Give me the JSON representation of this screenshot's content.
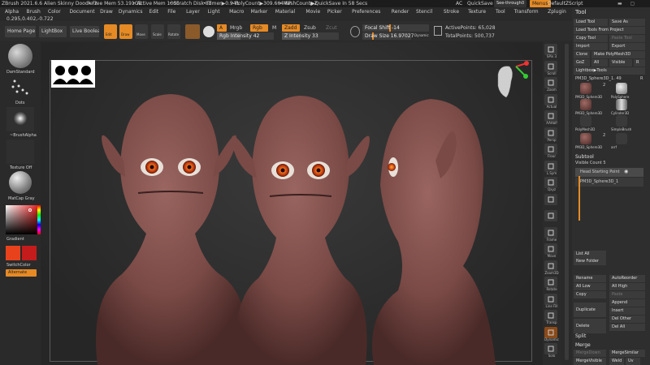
{
  "titlebar": {
    "app": "ZBrush 2021.6.6",
    "doc": "Alien Skinny Doodle 2",
    "free_mem": "• Free Mem 53.191GB",
    "active_mem": "• Active Mem 1305",
    "scratch": "• Scratch Disk 83",
    "timer": "• Timer▶0.941",
    "polycount": "• PolyCount▶309.664 KP",
    "meshcount": "• MeshCount▶2",
    "quicksave": "▶QuickSave In 58 Secs",
    "ac": "AC",
    "quicksave_btn": "QuickSave",
    "see_through": "See-through",
    "see_through_val": "0",
    "menus": "Menus",
    "default_script": "DefaultZScript"
  },
  "menubar": [
    "Alpha",
    "Brush",
    "Color",
    "Document",
    "Draw",
    "Dynamics",
    "Edit",
    "File",
    "Layer",
    "Light",
    "Macro",
    "Marker",
    "Material",
    "Movie",
    "Picker",
    "Preferences",
    "Render",
    "Stencil",
    "Stroke",
    "Texture",
    "Tool",
    "Transform",
    "Zplugin",
    "Zscript",
    "Help"
  ],
  "coords": "0.295,0.402,-0.722",
  "top": {
    "home_page": "Home Page",
    "lightbox": "LightBox",
    "live_boolean": "Live Boolean",
    "edit": "Edit",
    "draw": "Draw",
    "move": "Move",
    "scale": "Scale",
    "rotate": "Rotate",
    "a": "A",
    "mrgb": "Mrgb",
    "rgb": "Rgb",
    "m": "M",
    "zadd": "Zadd",
    "zsub": "Zsub",
    "zcut": "Zcut",
    "rgb_intensity": "Rgb Intensity 42",
    "rgb_intensity_value": 42,
    "z_intensity": "Z Intensity 33",
    "z_intensity_value": 33,
    "focal_shift": "Focal Shift -14",
    "draw_size": "Draw Size 16.97027",
    "dynamic": "Dynamic",
    "active_points": "ActivePoints: 65,028",
    "total_points": "TotalPoints: 500,737"
  },
  "left": {
    "brush": "DamStandard",
    "stroke": "Dots",
    "alpha": "~BrushAlpha",
    "texture": "Texture Off",
    "material": "MatCap Gray",
    "gradient": "Gradient",
    "switch_color": "SwitchColor",
    "alternate": "Alternate",
    "colors": {
      "primary": "#e8421c",
      "secondary": "#c41c1c"
    }
  },
  "right_shelf": [
    {
      "name": "spix-icon",
      "label": "SPix 3"
    },
    {
      "name": "scroll-icon",
      "label": "Scroll"
    },
    {
      "name": "zoom-icon",
      "label": "Zoom"
    },
    {
      "name": "actual-icon",
      "label": "Actual"
    },
    {
      "name": "aahalf-icon",
      "label": "AAHalf"
    },
    {
      "name": "persp-icon",
      "label": "Persp"
    },
    {
      "name": "floor-icon",
      "label": "Floor"
    },
    {
      "name": "local-icon",
      "label": "L.Sym"
    },
    {
      "name": "xyz-icon",
      "label": "Qxyz"
    },
    {
      "name": "y-icon",
      "label": ""
    },
    {
      "name": "z-icon",
      "label": ""
    },
    {
      "name": "frame-icon",
      "label": "Frame"
    },
    {
      "name": "move-icon",
      "label": "Move"
    },
    {
      "name": "zoom3d-icon",
      "label": "Zoom3D"
    },
    {
      "name": "rotate-icon",
      "label": "Rotate"
    },
    {
      "name": "linefill-icon",
      "label": "Line Fill"
    },
    {
      "name": "transp-icon",
      "label": "Transp"
    },
    {
      "name": "dynamic-icon",
      "label": "Dynamic"
    },
    {
      "name": "solo-icon",
      "label": "Solo"
    }
  ],
  "tool_panel": {
    "title": "Tool",
    "load_tool": "Load Tool",
    "save_as": "Save As",
    "load_from_project": "Load Tools From Project",
    "copy_tool": "Copy Tool",
    "paste_tool": "Paste Tool",
    "import": "Import",
    "export": "Export",
    "clone": "Clone",
    "make_polymesh": "Make PolyMesh3D",
    "goz": "GoZ",
    "all": "All",
    "visible": "Visible",
    "r": "R",
    "lightbox_tools": "Lightbox▶Tools",
    "current_tool": "PM3D_Sphere3D_1. 49",
    "r2": "R",
    "tools": [
      {
        "label": "PM3D_Sphere3D",
        "count": "2"
      },
      {
        "label": "PolySphere",
        "count": ""
      },
      {
        "label": "PM3D_Sphere3D",
        "count": ""
      },
      {
        "label": "Cylinder3D",
        "count": ""
      },
      {
        "label": "PolyMesh3D",
        "count": ""
      },
      {
        "label": "SimpleBrush",
        "count": ""
      },
      {
        "label": "PM3D_Sphere3D",
        "count": "2"
      },
      {
        "label": "arrf",
        "count": ""
      }
    ],
    "subtool": "Subtool",
    "visible_count": "Visible Count 5",
    "subtools": [
      {
        "label": "Head Starting Point"
      },
      {
        "label": "PM3D_Sphere3D_1"
      }
    ],
    "list_all": "List All",
    "new_folder": "New Folder",
    "rename": "Rename",
    "autoreorder": "AutoReorder",
    "all_low": "All Low",
    "all_high": "All High",
    "copy": "Copy",
    "paste": "Paste",
    "append": "Append",
    "duplicate": "Duplicate",
    "insert": "Insert",
    "delete": "Delete",
    "del_other": "Del Other",
    "del_all": "Del All",
    "split": "Split",
    "merge": "Merge",
    "merge_down": "MergeDown",
    "merge_similar": "MergeSimilar",
    "merge_visible": "MergeVisible",
    "weld": "Weld",
    "uv": "Uv"
  }
}
